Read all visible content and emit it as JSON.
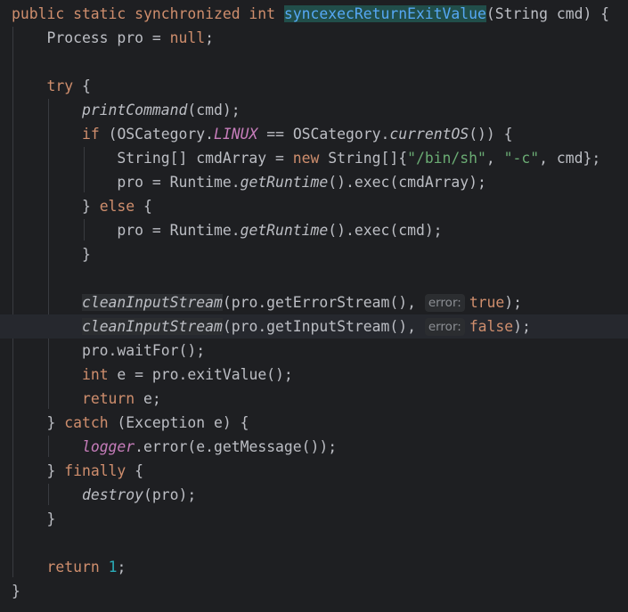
{
  "code": {
    "lines": [
      [
        {
          "t": "public static synchronized int ",
          "c": "kw"
        },
        {
          "t": "syncexecReturnExitValue",
          "c": "fnsel"
        },
        {
          "t": "(String cmd) {"
        }
      ],
      [
        {
          "t": "    Process pro = "
        },
        {
          "t": "null",
          "c": "kw"
        },
        {
          "t": ";"
        }
      ],
      [],
      [
        {
          "t": "    "
        },
        {
          "t": "try",
          "c": "kw"
        },
        {
          "t": " {"
        }
      ],
      [
        {
          "t": "        "
        },
        {
          "t": "printCommand",
          "c": "it"
        },
        {
          "t": "(cmd);"
        }
      ],
      [
        {
          "t": "        "
        },
        {
          "t": "if",
          "c": "kw"
        },
        {
          "t": " (OSCategory."
        },
        {
          "t": "LINUX",
          "c": "st"
        },
        {
          "t": " == OSCategory."
        },
        {
          "t": "currentOS",
          "c": "it"
        },
        {
          "t": "()) {"
        }
      ],
      [
        {
          "t": "            String[] cmdArray = "
        },
        {
          "t": "new",
          "c": "kw"
        },
        {
          "t": " String[]{"
        },
        {
          "t": "\"/bin/sh\"",
          "c": "str"
        },
        {
          "t": ", "
        },
        {
          "t": "\"-c\"",
          "c": "str"
        },
        {
          "t": ", cmd};"
        }
      ],
      [
        {
          "t": "            pro = Runtime."
        },
        {
          "t": "getRuntime",
          "c": "it"
        },
        {
          "t": "().exec(cmdArray);"
        }
      ],
      [
        {
          "t": "        } "
        },
        {
          "t": "else",
          "c": "kw"
        },
        {
          "t": " {"
        }
      ],
      [
        {
          "t": "            pro = Runtime."
        },
        {
          "t": "getRuntime",
          "c": "it"
        },
        {
          "t": "().exec(cmd);"
        }
      ],
      [
        {
          "t": "        }"
        }
      ],
      [],
      [
        {
          "t": "        "
        },
        {
          "t": "cleanInputStream",
          "c": "it unused"
        },
        {
          "t": "(pro.getErrorStream(), "
        },
        {
          "t": "error:",
          "c": "hint"
        },
        {
          "t": "true",
          "c": "kw"
        },
        {
          "t": ");"
        }
      ],
      [
        {
          "t": "        "
        },
        {
          "t": "cleanInputStream",
          "c": "it unused"
        },
        {
          "t": "(pro.getInputStream(), "
        },
        {
          "t": "error:",
          "c": "hint"
        },
        {
          "t": "false",
          "c": "kw"
        },
        {
          "t": ");"
        }
      ],
      [
        {
          "t": "        pro.waitFor();"
        }
      ],
      [
        {
          "t": "        "
        },
        {
          "t": "int",
          "c": "kw"
        },
        {
          "t": " e = pro.exitValue();"
        }
      ],
      [
        {
          "t": "        "
        },
        {
          "t": "return",
          "c": "kw"
        },
        {
          "t": " e;"
        }
      ],
      [
        {
          "t": "    } "
        },
        {
          "t": "catch",
          "c": "kw"
        },
        {
          "t": " (Exception e) {"
        }
      ],
      [
        {
          "t": "        "
        },
        {
          "t": "logger",
          "c": "st"
        },
        {
          "t": ".error(e.getMessage());"
        }
      ],
      [
        {
          "t": "    } "
        },
        {
          "t": "finally",
          "c": "kw"
        },
        {
          "t": " {"
        }
      ],
      [
        {
          "t": "        "
        },
        {
          "t": "destroy",
          "c": "it"
        },
        {
          "t": "(pro);"
        }
      ],
      [
        {
          "t": "    }"
        }
      ],
      [],
      [
        {
          "t": "    "
        },
        {
          "t": "return",
          "c": "kw"
        },
        {
          "t": " "
        },
        {
          "t": "1",
          "c": "num"
        },
        {
          "t": ";"
        }
      ],
      [
        {
          "t": "}"
        }
      ]
    ],
    "highlighted_line": 14
  }
}
